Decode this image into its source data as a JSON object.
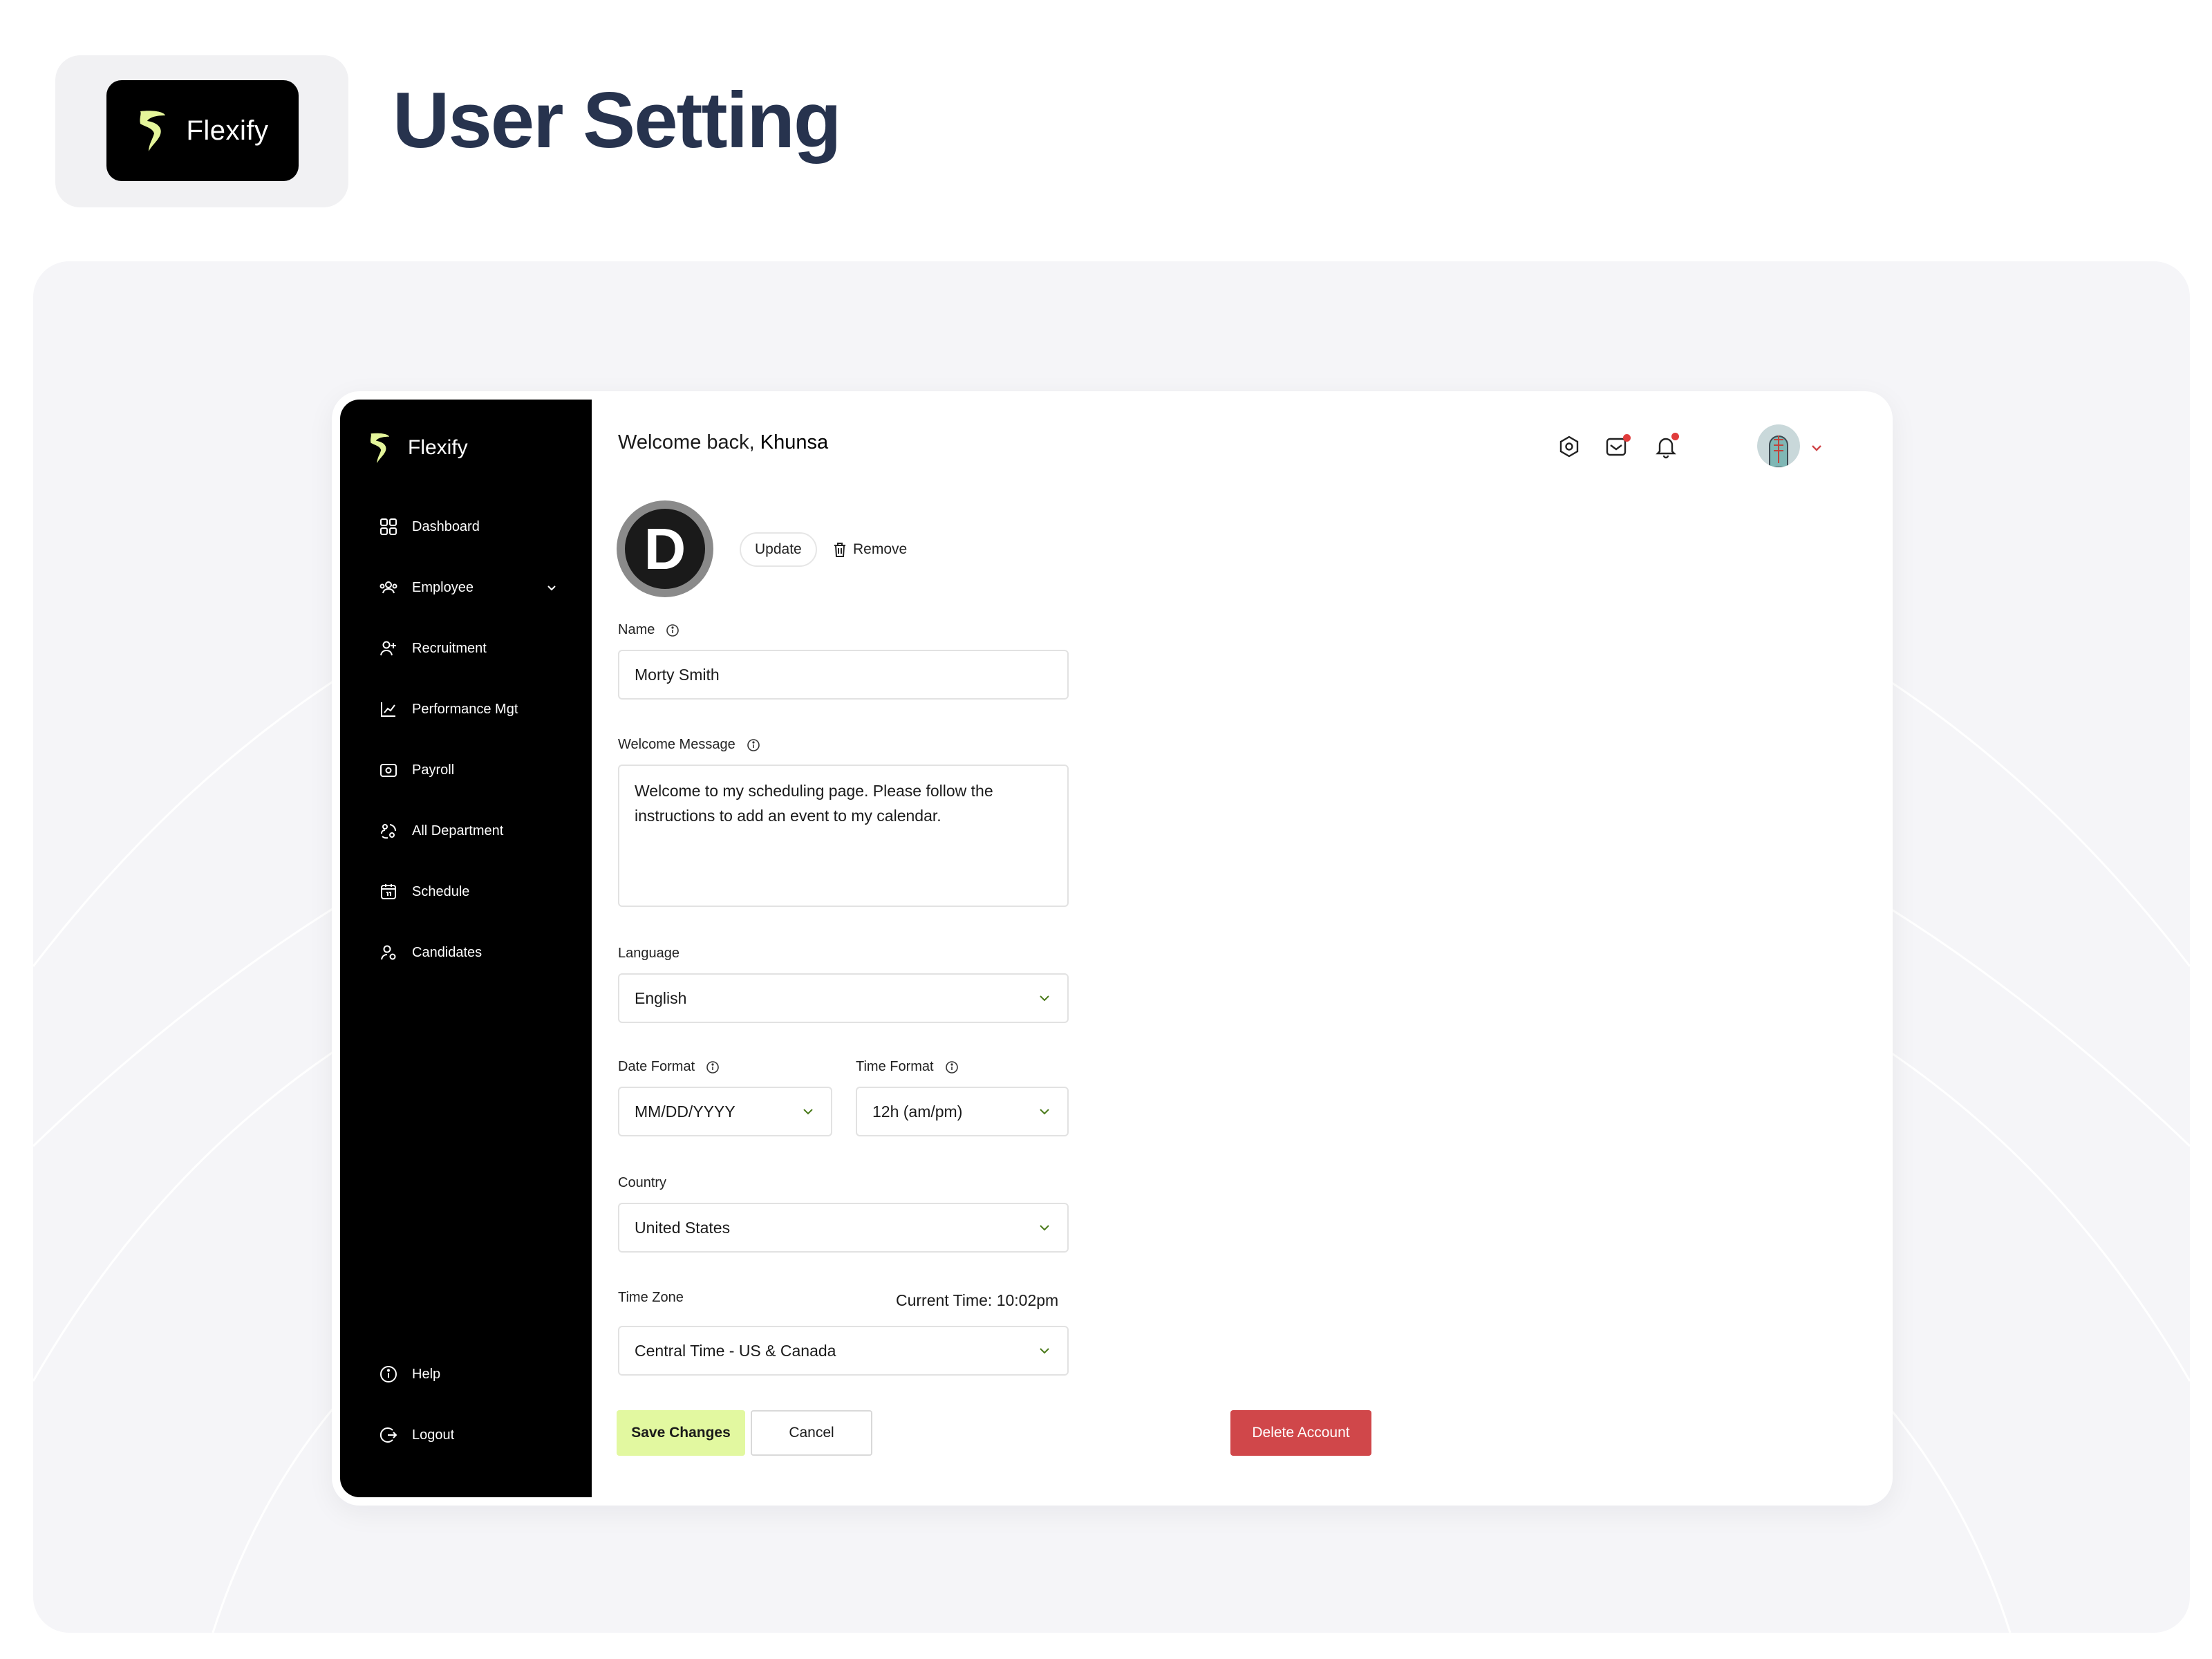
{
  "page": {
    "title": "User Setting",
    "brand_name": "Flexify"
  },
  "colors": {
    "title": "#27334e",
    "sidebar_bg": "#000000",
    "accent_green": "#e2f8a0",
    "brand_mark": "#e4f59a",
    "danger": "#d0474a",
    "notification_dot": "#e03b3b"
  },
  "sidebar": {
    "brand_name": "Flexify",
    "items": [
      {
        "label": "Dashboard",
        "icon": "grid-icon"
      },
      {
        "label": "Employee",
        "icon": "users-icon",
        "has_dropdown": true
      },
      {
        "label": "Recruitment",
        "icon": "user-plus-icon"
      },
      {
        "label": "Performance Mgt",
        "icon": "chart-line-icon"
      },
      {
        "label": "Payroll",
        "icon": "wallet-icon"
      },
      {
        "label": "All Department",
        "icon": "department-icon"
      },
      {
        "label": "Schedule",
        "icon": "calendar-icon"
      },
      {
        "label": "Candidates",
        "icon": "candidates-icon"
      }
    ],
    "footer_items": [
      {
        "label": "Help",
        "icon": "info-icon"
      },
      {
        "label": "Logout",
        "icon": "logout-icon"
      }
    ]
  },
  "header": {
    "welcome_prefix": "Welcome back,",
    "user_name": "Khunsa",
    "icons": [
      "settings-icon",
      "inbox-icon",
      "bell-icon"
    ]
  },
  "profile": {
    "avatar_letter": "D",
    "update_label": "Update",
    "remove_label": "Remove"
  },
  "form": {
    "name_label": "Name",
    "name_value": "Morty Smith",
    "welcome_label": "Welcome Message",
    "welcome_value": "Welcome to my scheduling page. Please follow the instructions to add an event to my calendar.",
    "language_label": "Language",
    "language_value": "English",
    "date_format_label": "Date Format",
    "date_format_value": "MM/DD/YYYY",
    "time_format_label": "Time Format",
    "time_format_value": "12h (am/pm)",
    "country_label": "Country",
    "country_value": "United States",
    "timezone_label": "Time Zone",
    "current_time": "Current Time: 10:02pm",
    "timezone_value": "Central Time - US & Canada"
  },
  "actions": {
    "save_label": "Save Changes",
    "cancel_label": "Cancel",
    "delete_label": "Delete Account"
  }
}
